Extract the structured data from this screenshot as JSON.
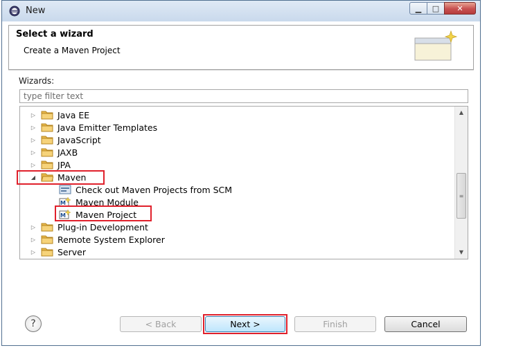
{
  "window": {
    "title": "New"
  },
  "header": {
    "title": "Select a wizard",
    "subtitle": "Create a Maven Project"
  },
  "wizards_label": "Wizards:",
  "filter": {
    "placeholder": "type filter text",
    "value": ""
  },
  "tree": {
    "items": [
      {
        "label": "Java EE",
        "type": "folder",
        "expanded": false
      },
      {
        "label": "Java Emitter Templates",
        "type": "folder",
        "expanded": false
      },
      {
        "label": "JavaScript",
        "type": "folder",
        "expanded": false
      },
      {
        "label": "JAXB",
        "type": "folder",
        "expanded": false
      },
      {
        "label": "JPA",
        "type": "folder",
        "expanded": false
      },
      {
        "label": "Maven",
        "type": "folder",
        "expanded": true
      },
      {
        "label": "Check out Maven Projects from SCM",
        "type": "item",
        "icon": "scm-checkout-icon"
      },
      {
        "label": "Maven Module",
        "type": "item",
        "icon": "maven-module-icon"
      },
      {
        "label": "Maven Project",
        "type": "item",
        "icon": "maven-project-icon",
        "selected": true
      },
      {
        "label": "Plug-in Development",
        "type": "folder",
        "expanded": false
      },
      {
        "label": "Remote System Explorer",
        "type": "folder",
        "expanded": false
      },
      {
        "label": "Server",
        "type": "folder",
        "expanded": false
      }
    ]
  },
  "buttons": {
    "help": "?",
    "back": "< Back",
    "next": "Next >",
    "finish": "Finish",
    "cancel": "Cancel"
  },
  "colors": {
    "highlight": "#e0202b",
    "folder": "#e8b84a"
  }
}
